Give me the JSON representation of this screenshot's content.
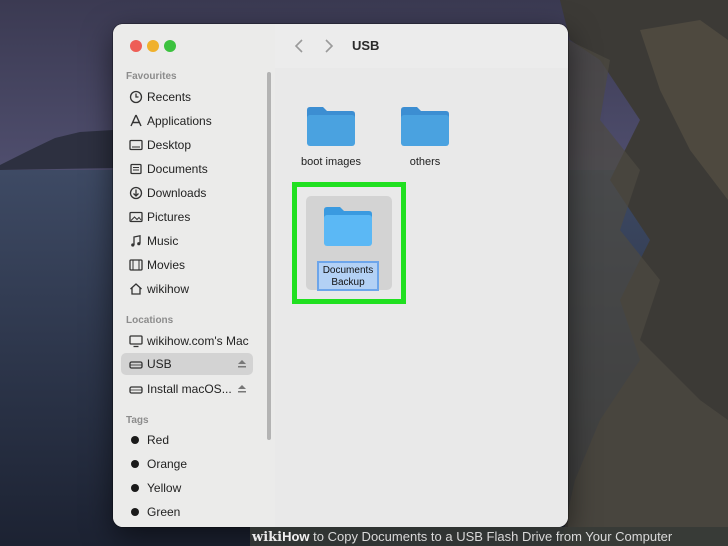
{
  "window": {
    "path_title": "USB"
  },
  "sidebar": {
    "favourites_header": "Favourites",
    "favourites": [
      {
        "label": "Recents",
        "icon": "clock-icon"
      },
      {
        "label": "Applications",
        "icon": "applications-icon"
      },
      {
        "label": "Desktop",
        "icon": "desktop-icon"
      },
      {
        "label": "Documents",
        "icon": "document-icon"
      },
      {
        "label": "Downloads",
        "icon": "download-icon"
      },
      {
        "label": "Pictures",
        "icon": "pictures-icon"
      },
      {
        "label": "Music",
        "icon": "music-icon"
      },
      {
        "label": "Movies",
        "icon": "movies-icon"
      },
      {
        "label": "wikihow",
        "icon": "home-icon"
      }
    ],
    "locations_header": "Locations",
    "locations": [
      {
        "label": "wikihow.com's Mac",
        "icon": "computer-icon"
      },
      {
        "label": "USB",
        "icon": "drive-icon",
        "selected": true
      },
      {
        "label": "Install macOS...",
        "icon": "drive-icon"
      }
    ],
    "tags_header": "Tags",
    "tags": [
      {
        "label": "Red",
        "color": "#1a1a1a"
      },
      {
        "label": "Orange",
        "color": "#1a1a1a"
      },
      {
        "label": "Yellow",
        "color": "#1a1a1a"
      },
      {
        "label": "Green",
        "color": "#1a1a1a"
      }
    ]
  },
  "files": [
    {
      "label": "boot images"
    },
    {
      "label": "others"
    }
  ],
  "selected_folder": {
    "label_line1": "Documents",
    "label_line2": "Backup"
  },
  "highlight_color": "#20e020",
  "caption": {
    "brand": "wiki",
    "how": "How",
    "rest": " to Copy Documents to a USB Flash Drive from Your Computer"
  }
}
